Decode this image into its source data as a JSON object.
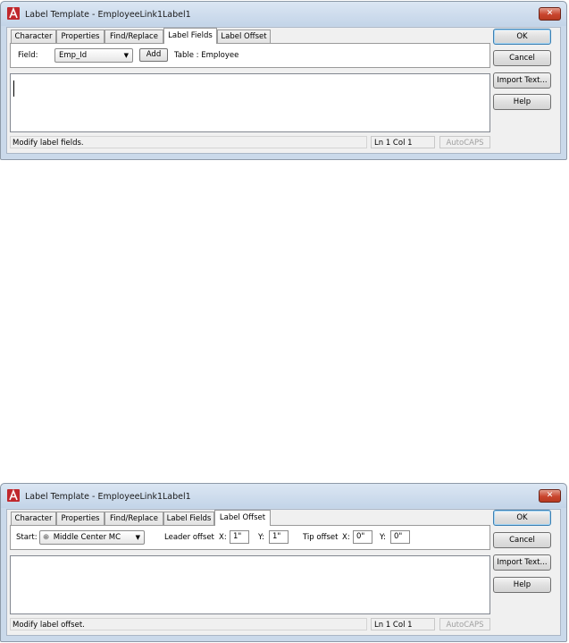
{
  "top_dialog": {
    "title": "Label Template - EmployeeLink1Label1",
    "close_label": "✕",
    "tabs": [
      "Character",
      "Properties",
      "Find/Replace",
      "Label Fields",
      "Label Offset"
    ],
    "active_tab": "Label Fields",
    "field_label": "Field:",
    "field_value": "Emp_Id",
    "add_label": "Add",
    "table_text": "Table : Employee",
    "editor_text": "",
    "status": {
      "message": "Modify label fields.",
      "position": "Ln 1 Col 1",
      "caps": "AutoCAPS"
    },
    "buttons": {
      "ok": "OK",
      "cancel": "Cancel",
      "import": "Import Text...",
      "help": "Help"
    }
  },
  "bottom_dialog": {
    "title": "Label Template - EmployeeLink1Label1",
    "close_label": "✕",
    "tabs": [
      "Character",
      "Properties",
      "Find/Replace",
      "Label Fields",
      "Label Offset"
    ],
    "active_tab": "Label Offset",
    "start_label": "Start:",
    "start_value": "Middle Center  MC",
    "leader_label": "Leader offset",
    "leader_x_label": "X:",
    "leader_x_value": "1\"",
    "leader_y_label": "Y:",
    "leader_y_value": "1\"",
    "tip_label": "Tip offset",
    "tip_x_label": "X:",
    "tip_x_value": "0\"",
    "tip_y_label": "Y:",
    "tip_y_value": "0\"",
    "editor_text": "",
    "status": {
      "message": "Modify label offset.",
      "position": "Ln 1 Col 1",
      "caps": "AutoCAPS"
    },
    "buttons": {
      "ok": "OK",
      "cancel": "Cancel",
      "import": "Import Text...",
      "help": "Help"
    }
  },
  "colors": {
    "frame": "#cad9ea",
    "close_button": "#c9452e",
    "app_icon": "#c0282d"
  },
  "icons": [
    "autocad-app-icon",
    "close-icon",
    "dropdown-arrow-icon",
    "justify-mc-icon"
  ]
}
